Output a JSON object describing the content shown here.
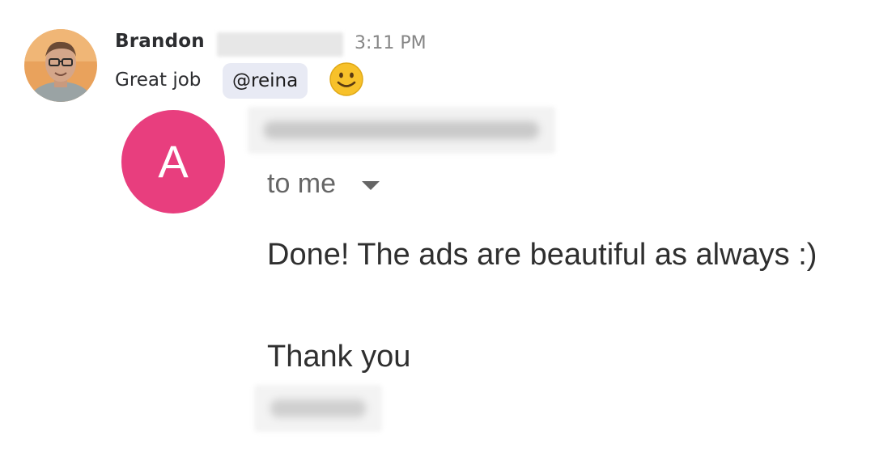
{
  "message": {
    "sender_name": "Brandon",
    "timestamp": "3:11 PM",
    "text": "Great job",
    "mention": "@reina",
    "emoji_icon": "slightly-smiling-face-icon"
  },
  "email_attachment": {
    "avatar_letter": "A",
    "avatar_color": "#e83e7e",
    "recipient_label": "to me",
    "body_line_1": "Done! The ads are beautiful as always :)",
    "body_line_2": "Thank you"
  },
  "colors": {
    "mention_background": "#e8eaf4",
    "emoji_face": "#f7c12a",
    "timestamp_text": "#868686"
  }
}
